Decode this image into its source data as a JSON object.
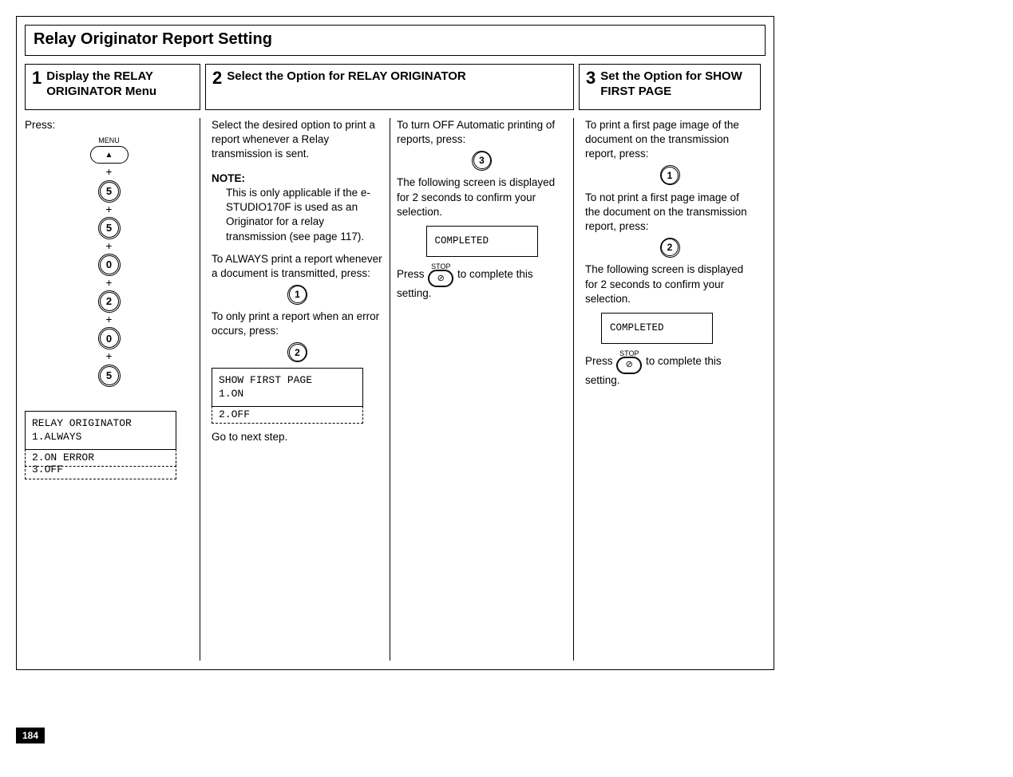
{
  "page_number": "184",
  "title": "Relay Originator Report Setting",
  "steps": {
    "s1": {
      "num": "1",
      "title": "Display the RELAY ORIGINATOR Menu"
    },
    "s2": {
      "num": "2",
      "title": "Select the Option for RELAY ORIGINATOR"
    },
    "s3": {
      "num": "3",
      "title": "Set the Option for SHOW FIRST PAGE"
    }
  },
  "col1": {
    "press": "Press:",
    "menu_label": "MENU",
    "menu_arrow": "▲",
    "keys": [
      "5",
      "5",
      "0",
      "2",
      "0",
      "5"
    ],
    "plus": "+",
    "lcd_title": "RELAY ORIGINATOR",
    "lcd_opt1": "1.ALWAYS",
    "lcd_opt2": "2.ON ERROR",
    "lcd_opt3": "3.OFF"
  },
  "col2": {
    "p1": "Select the desired option to print a report whenever a Relay transmission is sent.",
    "note_label": "NOTE:",
    "note_body": "This is only applicable if the e-STUDIO170F is used as an Originator for a relay transmission (see page 117).",
    "p2": "To ALWAYS print a report whenever a document is transmitted, press:",
    "key1": "1",
    "p3": "To only print a report when an error occurs, press:",
    "key2": "2",
    "lcd_title": "SHOW FIRST PAGE",
    "lcd_opt1": "1.ON",
    "lcd_opt2": "2.OFF",
    "next": "Go to next step."
  },
  "col3": {
    "p1": "To turn OFF Automatic printing of reports, press:",
    "key3": "3",
    "p2": "The following screen is displayed for 2 seconds to confirm your selection.",
    "completed": "COMPLETED",
    "press": "Press",
    "stop_label": "STOP",
    "stop_glyph": "⊘",
    "press_tail": "to complete this setting."
  },
  "col4": {
    "p1": "To print a first page image of the document on the transmission report, press:",
    "key1": "1",
    "p2": "To not print a first page image of the document on the transmission report, press:",
    "key2": "2",
    "p3": "The following screen is displayed for 2 seconds to confirm your selection.",
    "completed": "COMPLETED",
    "press": "Press",
    "stop_label": "STOP",
    "stop_glyph": "⊘",
    "press_tail": "to complete this setting."
  }
}
